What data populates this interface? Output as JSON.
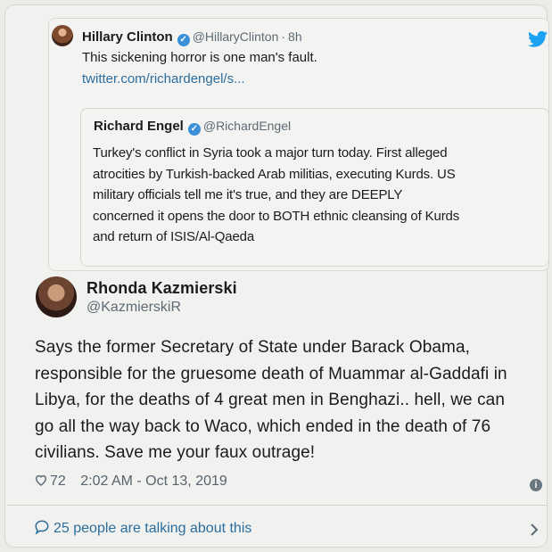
{
  "quoted_tweet": {
    "name": "Hillary Clinton",
    "handle": "@HillaryClinton",
    "separator": "·",
    "time": "8h",
    "text": "This sickening horror is one man's fault.",
    "link": "twitter.com/richardengel/s..."
  },
  "embedded_tweet": {
    "name": "Richard Engel",
    "handle": "@RichardEngel",
    "lines": [
      "Turkey's conflict in Syria took a major turn today. First alleged",
      "atrocities by Turkish-backed Arab militias, executing Kurds. US",
      "military officials tell me it's true, and they are DEEPLY",
      "concerned it opens the door to BOTH ethnic cleansing of Kurds",
      "and return of ISIS/Al-Qaeda"
    ]
  },
  "main_tweet": {
    "name": "Rhonda Kazmierski",
    "handle": "@KazmierskiR",
    "lines": [
      "Says the former Secretary of State under Barack Obama,",
      "responsible for the gruesome death of Muammar al-Gaddafi in",
      "Libya, for the deaths of 4 great men in Benghazi.. hell, we can",
      "go all the way back to Waco, which ended in the death of 76",
      "civilians.  Save me your faux outrage!"
    ],
    "likes": "72",
    "timestamp": "2:02 AM - Oct 13, 2019",
    "talking": "25 people are talking about this"
  },
  "icons": {
    "verified": "verified-badge-icon",
    "bird": "twitter-bird-icon",
    "like": "heart-icon",
    "info": "info-icon",
    "reply": "speech-bubble-icon",
    "chevron": "chevron-right-icon"
  },
  "colors": {
    "link": "#2b6e9e",
    "verified": "#3a8fd8",
    "twitter_blue": "#1da1f2",
    "muted": "#5d6a74"
  }
}
